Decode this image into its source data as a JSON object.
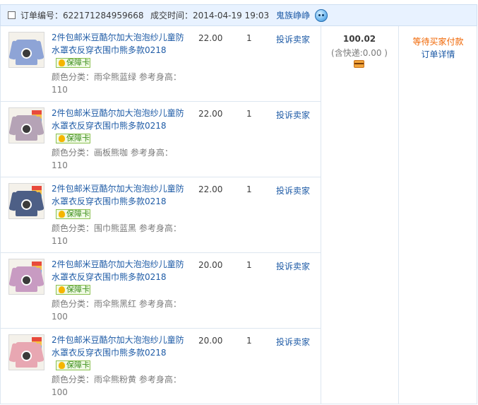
{
  "order": {
    "number_label": "订单编号：",
    "number": "622171284959668",
    "time_label": "成交时间：",
    "time": "2014-04-19 19:03",
    "seller": "鬼族峥峥",
    "chat_icon": "wangwang-icon",
    "total": "100.02",
    "shipping": "(含快递:0.00 )",
    "payment_icon": "card-icon",
    "status": "等待买家付款",
    "detail_link": "订单详情"
  },
  "colors": {
    "link": "#1e5ba6",
    "status": "#f06400",
    "header_bg": "#e8f2ff",
    "border": "#dde6f0"
  },
  "items": [
    {
      "title": "2件包邮米豆酷尔加大泡泡纱儿童防水罩衣反穿衣围巾熊多款0218",
      "badge": "保障卡",
      "attrs": "颜色分类：雨伞熊蓝绿 参考身高：110",
      "price": "22.00",
      "qty": "1",
      "complain": "投诉卖家",
      "thumb_color": "#8ea4d6"
    },
    {
      "title": "2件包邮米豆酷尔加大泡泡纱儿童防水罩衣反穿衣围巾熊多款0218",
      "badge": "保障卡",
      "attrs": "颜色分类：画板熊咖 参考身高：110",
      "price": "22.00",
      "qty": "1",
      "complain": "投诉卖家",
      "thumb_color": "#b5a3b6"
    },
    {
      "title": "2件包邮米豆酷尔加大泡泡纱儿童防水罩衣反穿衣围巾熊多款0218",
      "badge": "保障卡",
      "attrs": "颜色分类：围巾熊蓝黑 参考身高：110",
      "price": "22.00",
      "qty": "1",
      "complain": "投诉卖家",
      "thumb_color": "#4d5f86"
    },
    {
      "title": "2件包邮米豆酷尔加大泡泡纱儿童防水罩衣反穿衣围巾熊多款0218",
      "badge": "保障卡",
      "attrs": "颜色分类：雨伞熊黑红 参考身高：100",
      "price": "20.00",
      "qty": "1",
      "complain": "投诉卖家",
      "thumb_color": "#c89bc2"
    },
    {
      "title": "2件包邮米豆酷尔加大泡泡纱儿童防水罩衣反穿衣围巾熊多款0218",
      "badge": "保障卡",
      "attrs": "颜色分类：雨伞熊粉黄 参考身高：100",
      "price": "20.00",
      "qty": "1",
      "complain": "投诉卖家",
      "thumb_color": "#e8a7b2"
    }
  ]
}
